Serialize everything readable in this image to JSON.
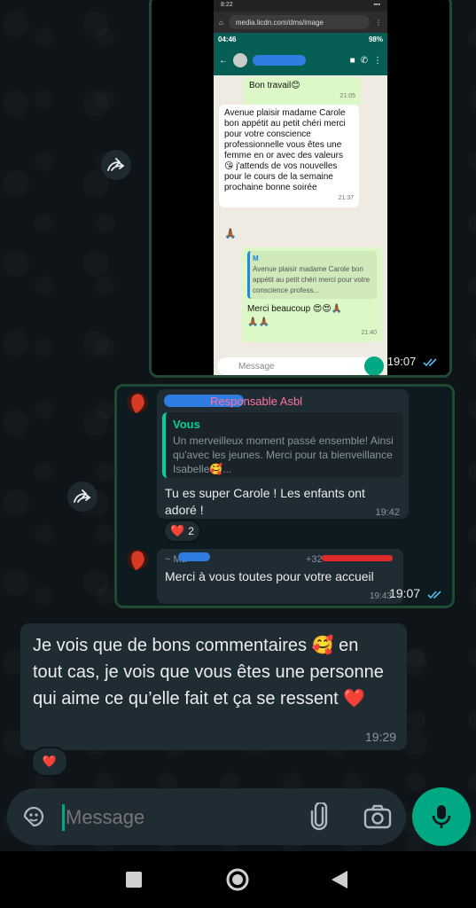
{
  "screenshot_image": {
    "browser_status_time": "8:22",
    "url": "media.licdn.com/dms/image",
    "phone_time": "04:46",
    "phone_battery": "98%",
    "messages": [
      {
        "text": "Bon travail😊",
        "time": "21:05"
      },
      {
        "text": "Avenue plaisir madame Carole bon appétit au petit chéri merci pour votre conscience professionnelle vous êtes une femme en or avec des valeurs 😘 j'attends de vos nouvelles pour le cours de la semaine prochaine bonne soirée",
        "time": "21:37"
      },
      {
        "reaction": "🙏🏾"
      },
      {
        "quote_author": "M",
        "quote_text": "Avenue plaisir madame Carole bon appétit au petit chéri merci pour votre conscience profess...",
        "text": "Merci beaucoup 😍😍🙏🏾",
        "reaction_line": "🙏🏾🙏🏾",
        "time": "21:40"
      },
      {
        "reaction": "😮"
      }
    ],
    "input_placeholder": "Message"
  },
  "forwarded_image_time": "19:07",
  "group_message_1": {
    "role": "Responsable Asbl",
    "quote_author": "Vous",
    "quote_text": "Un merveilleux moment passé ensemble! Ainsi qu'avec les jeunes. Merci pour ta bienveillance Isabelle🥰...",
    "text": "Tu es super Carole ! Les enfants ont adoré !",
    "time": "19:42",
    "reaction": "❤️",
    "reaction_count": "2"
  },
  "group_message_2": {
    "name_prefix": "~ Ma",
    "phone": "+32",
    "text": "Merci à vous toutes pour votre accueil",
    "time_inner": "19:43",
    "time": "19:07"
  },
  "main_message": {
    "text": "Je vois que de bons commentaires 🥰 en tout cas, je vois que vous êtes une personne qui aime ce qu’elle fait et ça se ressent ❤️",
    "time": "19:29",
    "reaction": "❤️"
  },
  "input": {
    "placeholder": "Message"
  },
  "colors": {
    "accent": "#00a884",
    "bubble": "#202c33",
    "forward_border": "#1f4a33",
    "tick_blue": "#53bdeb",
    "role_pink": "#ff72a1"
  }
}
